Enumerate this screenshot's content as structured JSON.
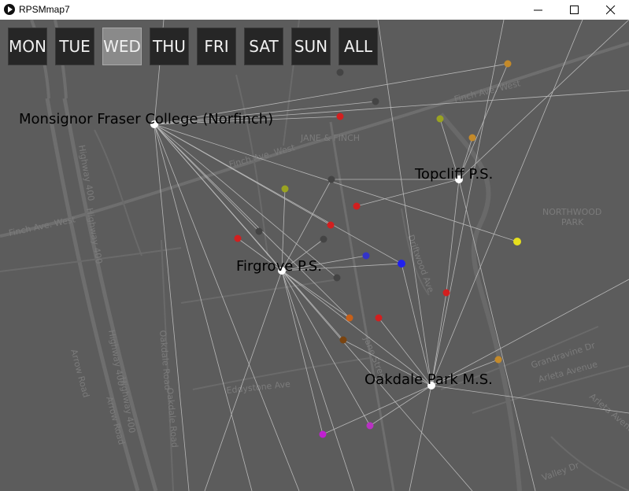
{
  "window": {
    "title": "RPSMmap7"
  },
  "days": {
    "items": [
      "MON",
      "TUE",
      "WED",
      "THU",
      "FRI",
      "SAT",
      "SUN",
      "ALL"
    ],
    "active": "WED"
  },
  "schools": [
    {
      "name": "Monsignor Fraser College (Norfinch)"
    },
    {
      "name": "Topcliff P.S."
    },
    {
      "name": "Firgrove P.S."
    },
    {
      "name": "Oakdale Park M.S."
    }
  ],
  "map_labels": [
    "JANE & FINCH",
    "NORTHWOOD",
    "PARK",
    "Finch Ave. West",
    "Finch Ave. West",
    "Finch Ave. West",
    "Highway 400",
    "Highway 400",
    "Highway 400",
    "Highway 400",
    "Arrow Road",
    "Arrow Road",
    "Oakdale Road",
    "Oakdale Road",
    "Eddystone Ave",
    "Jane Street",
    "Driftwood Ave",
    "Grandravine Dr",
    "Arleta Avenue",
    "Arleta Avenue",
    "Valley Dr"
  ],
  "colors": {
    "point_colors": [
      "#444444",
      "#d21f1f",
      "#9aa321",
      "#c48a2a",
      "#e6e01d",
      "#3434c8",
      "#c7601a",
      "#7a4410",
      "#b832c2"
    ]
  }
}
